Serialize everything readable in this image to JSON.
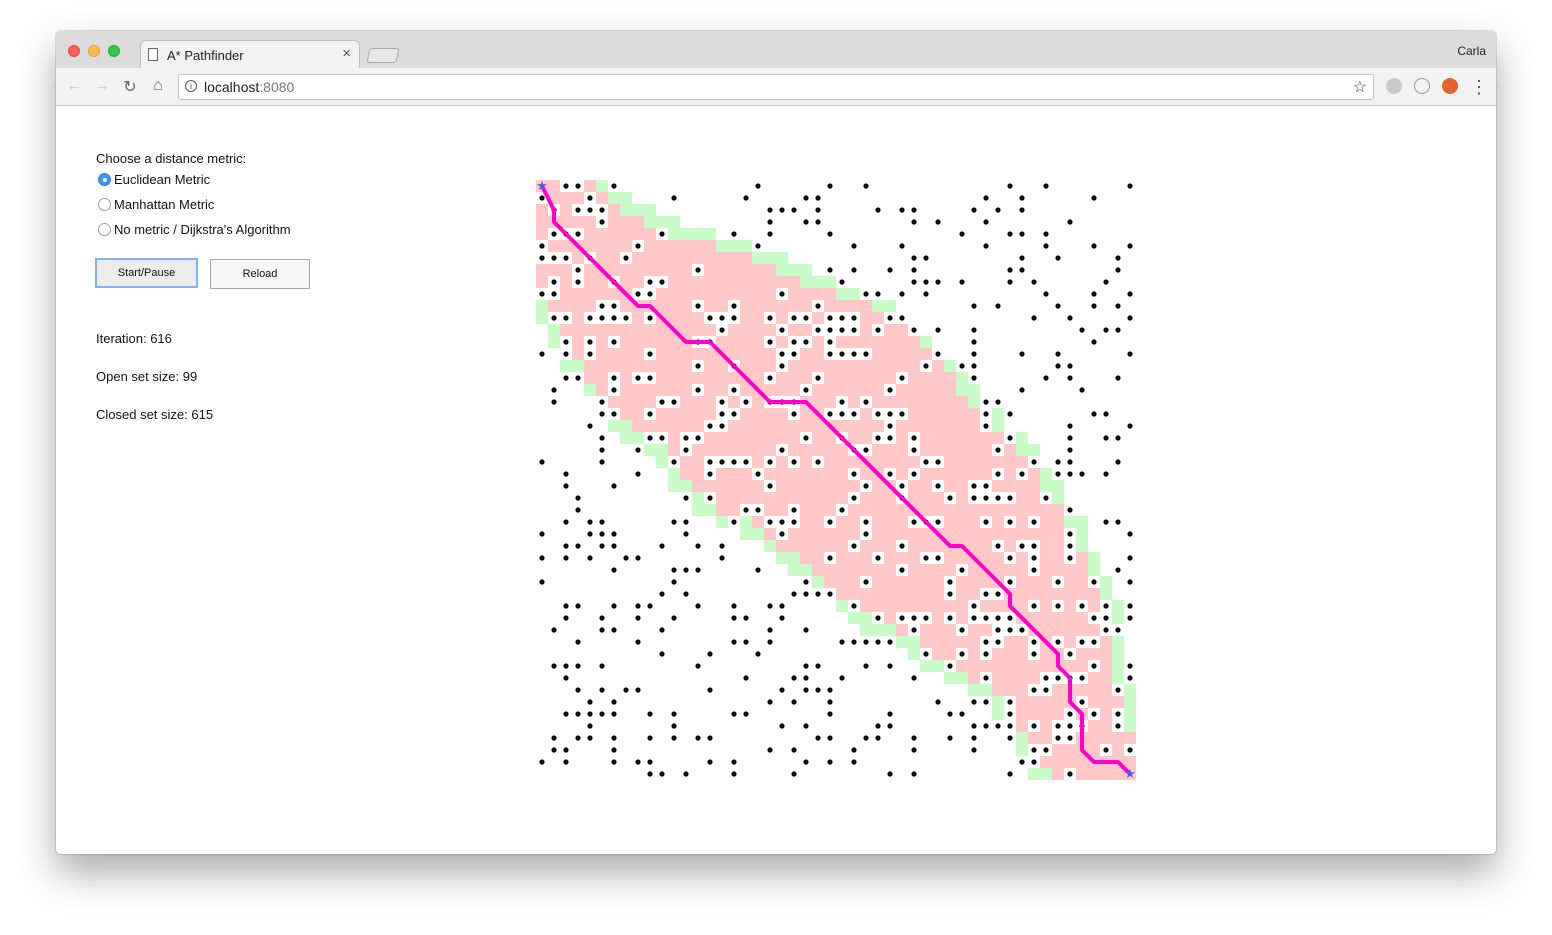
{
  "browser": {
    "tab_title": "A* Pathfinder",
    "profile_name": "Carla",
    "url_host": "localhost",
    "url_port": ":8080",
    "icons": [
      "back-arrow-icon",
      "forward-arrow-icon",
      "reload-icon",
      "home-icon",
      "info-icon",
      "bookmark-star-icon",
      "menu-dots-icon"
    ]
  },
  "controls": {
    "prompt": "Choose a distance metric:",
    "metrics": [
      {
        "label": "Euclidean Metric",
        "checked": true
      },
      {
        "label": "Manhattan Metric",
        "checked": false
      },
      {
        "label": "No metric / Dijkstra's Algorithm",
        "checked": false
      }
    ],
    "start_label": "Start/Pause",
    "reload_label": "Reload"
  },
  "stats": {
    "iteration": "Iteration: 616",
    "open_set": "Open set size: 99",
    "closed_set": "Closed set size: 615"
  },
  "grid": {
    "size": 50,
    "colors": {
      "closed": "#ffc7c7",
      "open": "#c9fcc9",
      "path": "#ff00cc",
      "obstacle": "#000000",
      "endpoint": "#4a5fe0"
    },
    "seed": 616
  }
}
